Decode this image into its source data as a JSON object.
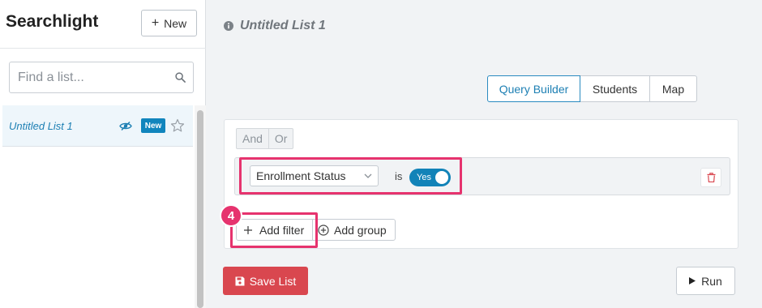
{
  "sidebar": {
    "app_title": "Searchlight",
    "new_button_label": "New",
    "search": {
      "placeholder": "Find a list...",
      "value": ""
    },
    "lists": [
      {
        "name": "Untitled List 1",
        "badge": "New",
        "starred": false
      }
    ]
  },
  "main": {
    "list_title": "Untitled List 1",
    "tabs": [
      {
        "label": "Query Builder",
        "active": true
      },
      {
        "label": "Students",
        "active": false
      },
      {
        "label": "Map",
        "active": false
      }
    ],
    "query": {
      "combinators": [
        "And",
        "Or"
      ],
      "rule": {
        "field": "Enrollment Status",
        "operator": "is",
        "value_label": "Yes",
        "value": true
      },
      "add_filter_label": "Add filter",
      "add_group_label": "Add group"
    },
    "step_badge": "4",
    "save_label": "Save List",
    "run_label": "Run"
  },
  "colors": {
    "accent": "#1283b8",
    "highlight": "#e6336e",
    "save": "#d9474f",
    "link": "#1c7fb3"
  },
  "icons": {
    "search": "search-icon",
    "visibility": "eye-icon",
    "star": "star-icon",
    "info": "info-icon",
    "dropdown": "chevron-down-icon",
    "delete": "trash-icon",
    "add": "plus-icon",
    "add_group": "plus-circle-icon",
    "save": "save-icon",
    "run": "play-icon"
  }
}
